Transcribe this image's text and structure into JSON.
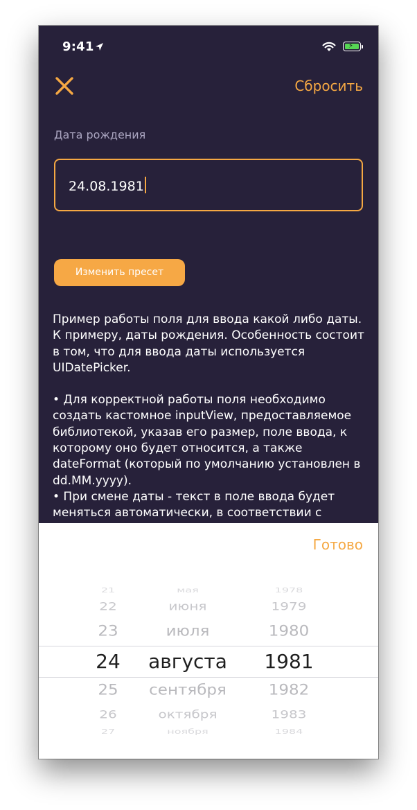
{
  "status_bar": {
    "time": "9:41"
  },
  "nav": {
    "reset_label": "Сбросить"
  },
  "field": {
    "label": "Дата рождения",
    "value": "24.08.1981"
  },
  "preset_button": "Изменить пресет",
  "description": [
    "Пример работы поля для ввода какой либо даты.\nК примеру, даты рождения. Особенность состоит\nв том, что для ввода даты используется\nUIDatePicker.",
    "• Для корректной работы поля необходимо\nсоздать кастомное inputView, предоставляемое\nбиблиотекой, указав его размер, поле ввода, к\nкоторому оно будет относится, а также\ndateFormat (который по умолчанию установлен в\ndd.MM.yyyy).\n• При смене даты - текст в поле ввода будет\nменяться автоматически, в соответствии с"
  ],
  "picker": {
    "done_label": "Готово",
    "days": [
      "21",
      "22",
      "23",
      "24",
      "25",
      "26",
      "27"
    ],
    "months": [
      "мая",
      "июня",
      "июля",
      "августа",
      "сентября",
      "октября",
      "ноября"
    ],
    "years": [
      "1978",
      "1979",
      "1980",
      "1981",
      "1982",
      "1983",
      "1984"
    ],
    "selected_index": 3
  },
  "colors": {
    "background": "#27213a",
    "accent": "#f5a843",
    "text": "#ffffff",
    "label": "#a9a4bf"
  }
}
